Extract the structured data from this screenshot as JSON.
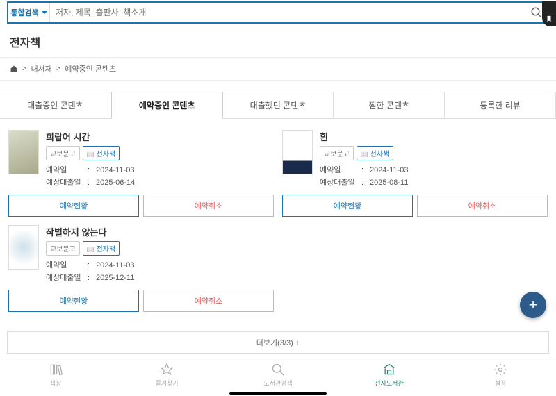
{
  "search": {
    "type_label": "통합검색",
    "placeholder": "저자, 제목, 출판사, 책소개"
  },
  "page_title": "전자책",
  "breadcrumb": {
    "lib": "내서재",
    "current": "예약중인 콘텐츠"
  },
  "tabs": [
    {
      "label": "대출중인 콘텐츠"
    },
    {
      "label": "예약중인 콘텐츠"
    },
    {
      "label": "대출했던 콘텐츠"
    },
    {
      "label": "찜한 콘텐츠"
    },
    {
      "label": "등록한 리뷰"
    }
  ],
  "badges": {
    "publisher": "교보문고",
    "format": "전자책"
  },
  "labels": {
    "reserve_date": "예약일",
    "expected_date": "예상대출일",
    "status": "예약현황",
    "cancel": "예약취소"
  },
  "books": [
    {
      "title": "희랍어 시간",
      "reserve": "2024-11-03",
      "expected": "2025-06-14"
    },
    {
      "title": "흰",
      "reserve": "2024-11-03",
      "expected": "2025-08-11"
    },
    {
      "title": "작별하지 않는다",
      "reserve": "2024-11-03",
      "expected": "2025-12-11"
    }
  ],
  "load_more": "더보기(3/3) +",
  "nav": [
    {
      "label": "책장"
    },
    {
      "label": "즐겨찾기"
    },
    {
      "label": "도서관검색"
    },
    {
      "label": "전자도서관"
    },
    {
      "label": "설정"
    }
  ]
}
